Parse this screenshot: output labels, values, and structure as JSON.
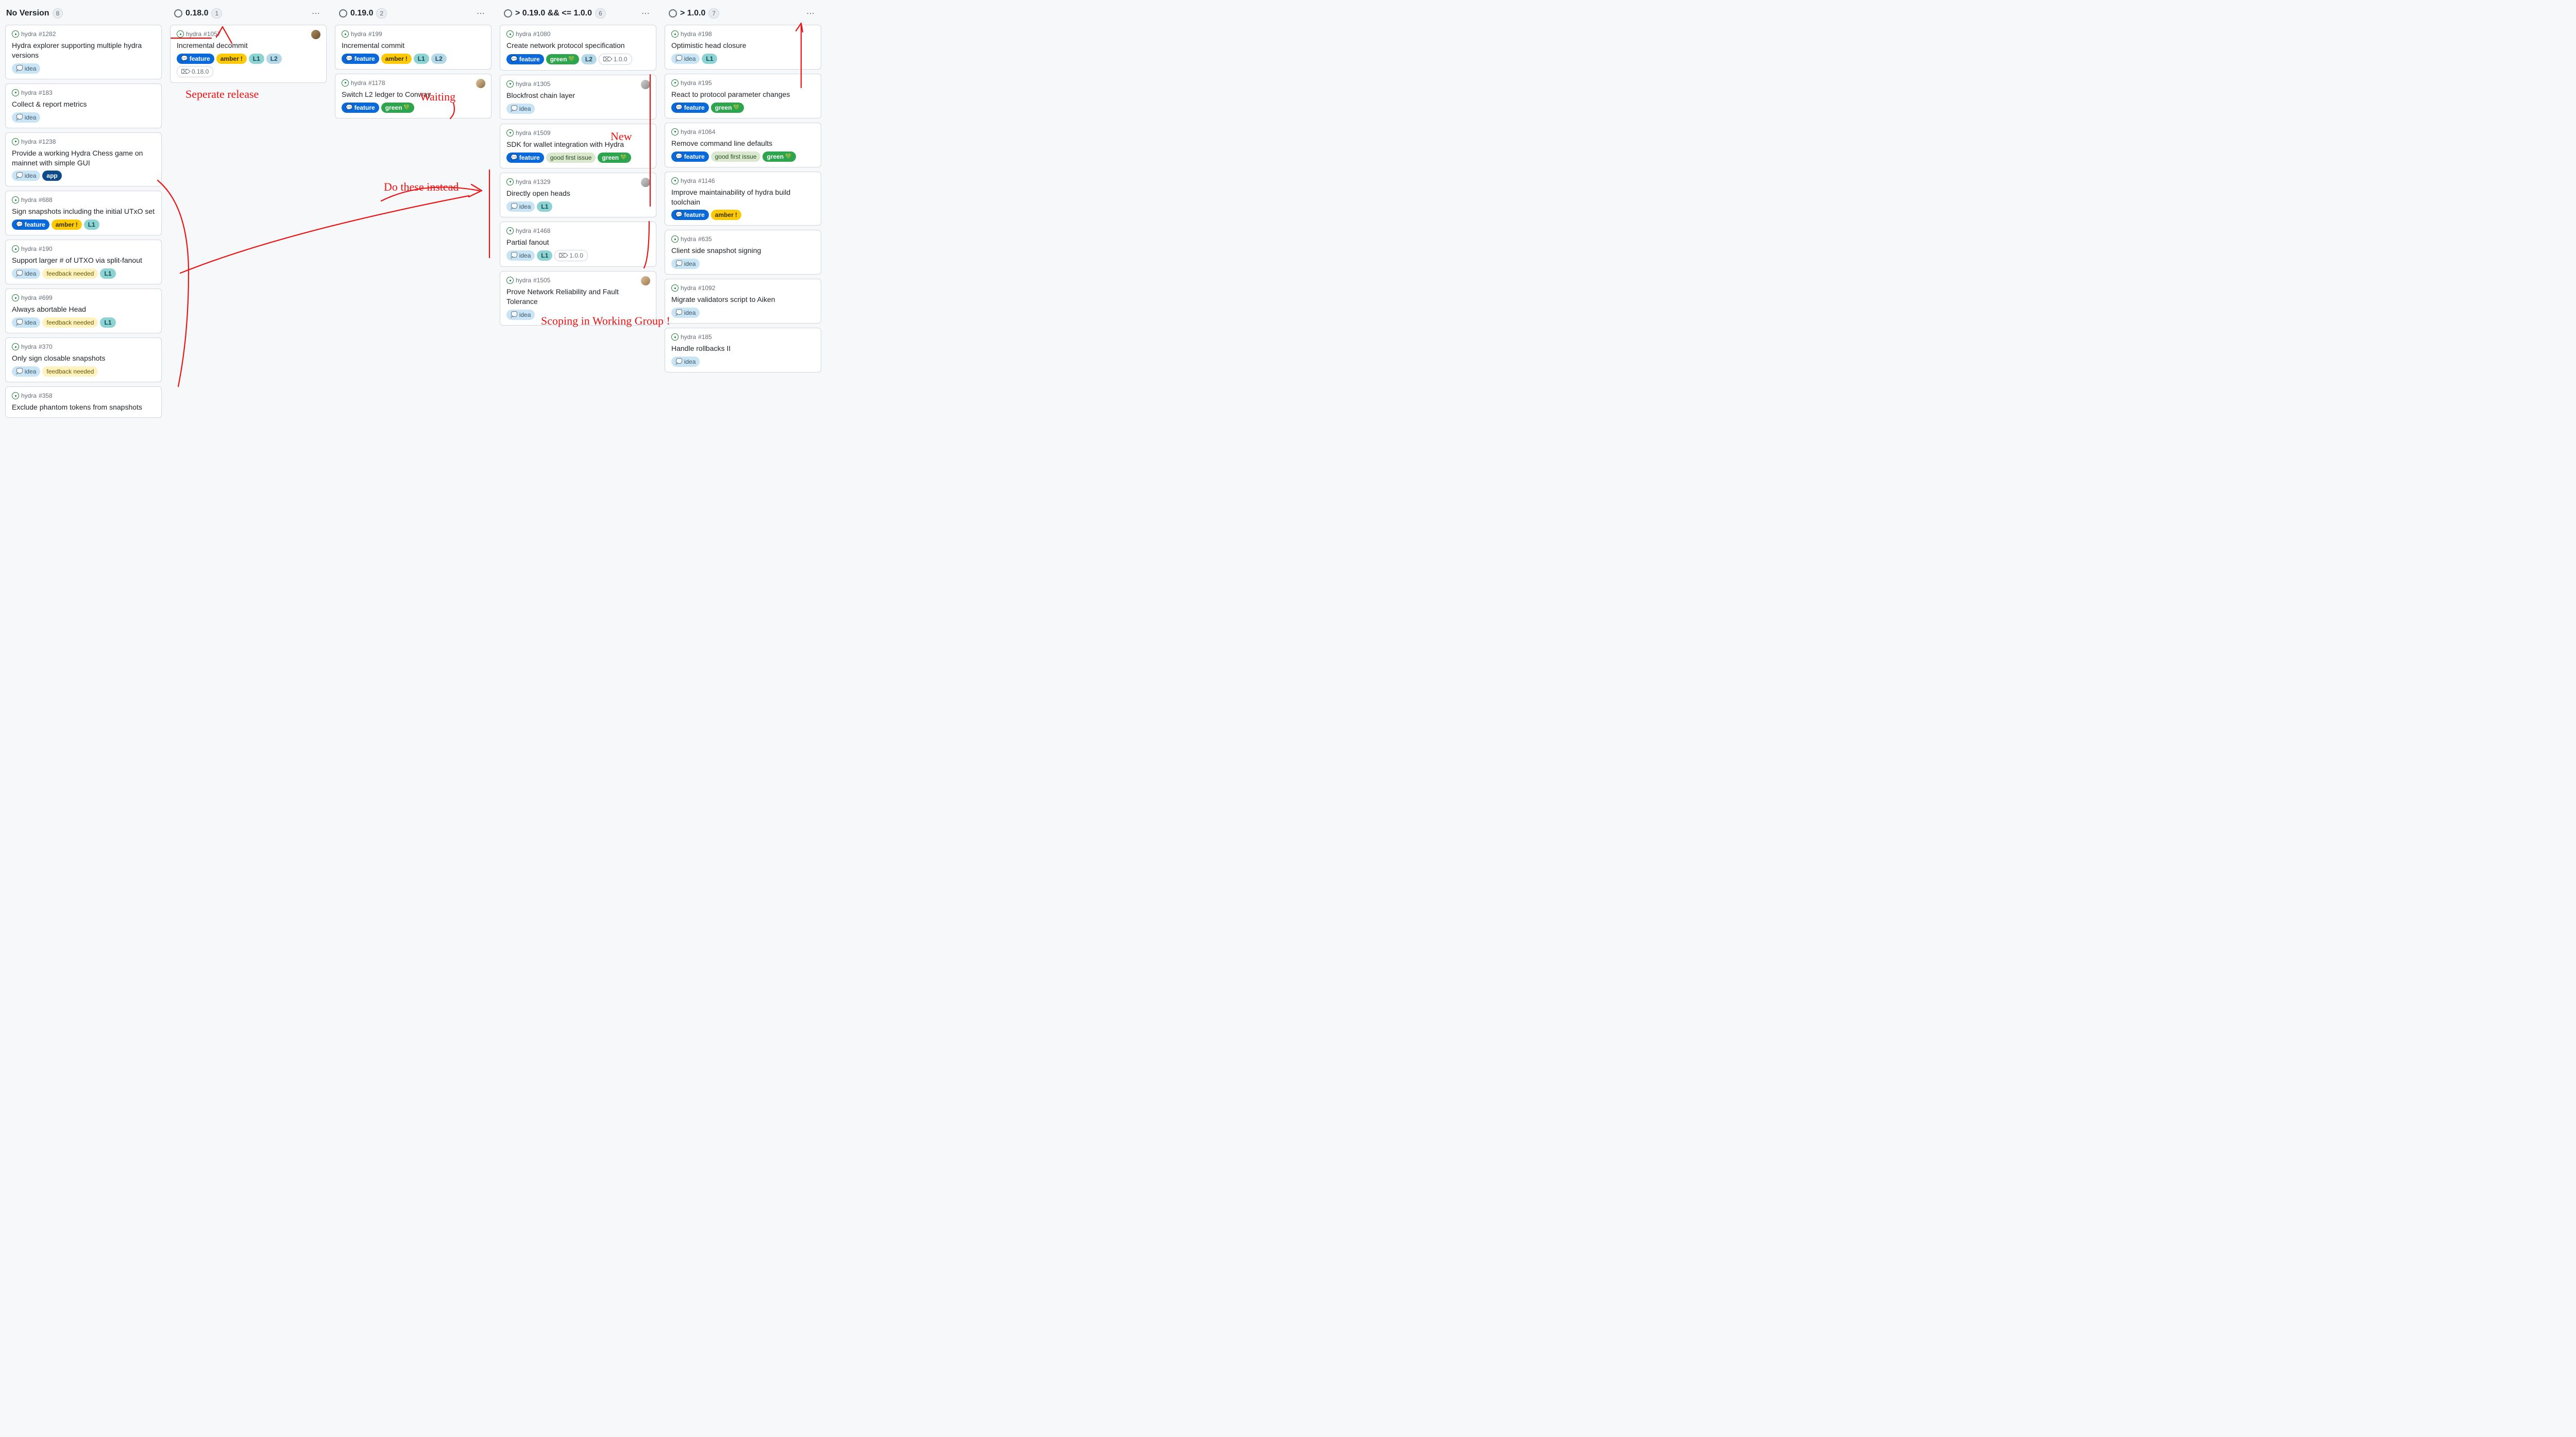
{
  "columns": [
    {
      "id": "noversion",
      "title": "No Version",
      "count": "8",
      "has_status_circle": false,
      "has_menu": false,
      "cards": [
        {
          "repo": "hydra",
          "num": "#1282",
          "title": "Hydra explorer supporting multiple hydra versions",
          "labels": [
            {
              "kind": "idea",
              "text": "idea"
            }
          ]
        },
        {
          "repo": "hydra",
          "num": "#183",
          "title": "Collect & report metrics",
          "labels": [
            {
              "kind": "idea",
              "text": "idea"
            }
          ]
        },
        {
          "repo": "hydra",
          "num": "#1238",
          "title": "Provide a working Hydra Chess game on mainnet with simple GUI",
          "labels": [
            {
              "kind": "idea",
              "text": "idea"
            },
            {
              "kind": "app",
              "text": "app"
            }
          ]
        },
        {
          "repo": "hydra",
          "num": "#688",
          "title": "Sign snapshots including the initial UTxO set",
          "labels": [
            {
              "kind": "feature",
              "text": "feature"
            },
            {
              "kind": "amber",
              "text": "amber"
            },
            {
              "kind": "L1",
              "text": "L1"
            }
          ]
        },
        {
          "repo": "hydra",
          "num": "#190",
          "title": "Support larger # of UTXO via split-fanout",
          "labels": [
            {
              "kind": "idea",
              "text": "idea"
            },
            {
              "kind": "feedback",
              "text": "feedback needed"
            },
            {
              "kind": "L1",
              "text": "L1"
            }
          ]
        },
        {
          "repo": "hydra",
          "num": "#699",
          "title": "Always abortable Head",
          "labels": [
            {
              "kind": "idea",
              "text": "idea"
            },
            {
              "kind": "feedback",
              "text": "feedback needed"
            },
            {
              "kind": "L1",
              "text": "L1"
            }
          ]
        },
        {
          "repo": "hydra",
          "num": "#370",
          "title": "Only sign closable snapshots",
          "labels": [
            {
              "kind": "idea",
              "text": "idea"
            },
            {
              "kind": "feedback",
              "text": "feedback needed"
            }
          ]
        },
        {
          "repo": "hydra",
          "num": "#358",
          "title": "Exclude phantom tokens from snapshots",
          "labels": []
        }
      ]
    },
    {
      "id": "v018",
      "title": "0.18.0",
      "count": "1",
      "has_status_circle": true,
      "has_menu": true,
      "cards": [
        {
          "repo": "hydra",
          "num": "#1057",
          "title": "Incremental decommit",
          "avatar": "a1",
          "labels": [
            {
              "kind": "feature",
              "text": "feature"
            },
            {
              "kind": "amber",
              "text": "amber"
            },
            {
              "kind": "L1",
              "text": "L1"
            },
            {
              "kind": "L2",
              "text": "L2"
            },
            {
              "kind": "milestone",
              "text": "0.18.0"
            }
          ]
        }
      ]
    },
    {
      "id": "v019",
      "title": "0.19.0",
      "count": "2",
      "has_status_circle": true,
      "has_menu": true,
      "cards": [
        {
          "repo": "hydra",
          "num": "#199",
          "title": "Incremental commit",
          "labels": [
            {
              "kind": "feature",
              "text": "feature"
            },
            {
              "kind": "amber",
              "text": "amber"
            },
            {
              "kind": "L1",
              "text": "L1"
            },
            {
              "kind": "L2",
              "text": "L2"
            }
          ]
        },
        {
          "repo": "hydra",
          "num": "#1178",
          "title": "Switch L2 ledger to Conway",
          "avatar": "a2",
          "labels": [
            {
              "kind": "feature",
              "text": "feature"
            },
            {
              "kind": "green",
              "text": "green"
            }
          ]
        }
      ]
    },
    {
      "id": "gt019lte100",
      "title": "> 0.19.0 && <= 1.0.0",
      "count": "6",
      "has_status_circle": true,
      "has_menu": true,
      "cards": [
        {
          "repo": "hydra",
          "num": "#1080",
          "title": "Create network protocol specification",
          "labels": [
            {
              "kind": "feature",
              "text": "feature"
            },
            {
              "kind": "green",
              "text": "green"
            },
            {
              "kind": "L2",
              "text": "L2"
            },
            {
              "kind": "milestone",
              "text": "1.0.0"
            }
          ]
        },
        {
          "repo": "hydra",
          "num": "#1305",
          "title": "Blockfrost chain layer",
          "avatar": "a3",
          "labels": [
            {
              "kind": "idea",
              "text": "idea"
            }
          ]
        },
        {
          "repo": "hydra",
          "num": "#1509",
          "title": "SDK for wallet integration with Hydra",
          "labels": [
            {
              "kind": "feature",
              "text": "feature"
            },
            {
              "kind": "goodfirst",
              "text": "good first issue"
            },
            {
              "kind": "green",
              "text": "green"
            }
          ]
        },
        {
          "repo": "hydra",
          "num": "#1329",
          "title": "Directly open heads",
          "avatar": "a3",
          "labels": [
            {
              "kind": "idea",
              "text": "idea"
            },
            {
              "kind": "L1",
              "text": "L1"
            }
          ]
        },
        {
          "repo": "hydra",
          "num": "#1468",
          "title": "Partial fanout",
          "labels": [
            {
              "kind": "idea",
              "text": "idea"
            },
            {
              "kind": "L1",
              "text": "L1"
            },
            {
              "kind": "milestone",
              "text": "1.0.0"
            }
          ]
        },
        {
          "repo": "hydra",
          "num": "#1505",
          "title": "Prove Network Reliability and Fault Tolerance",
          "avatar": "a4",
          "labels": [
            {
              "kind": "idea",
              "text": "idea"
            }
          ]
        }
      ]
    },
    {
      "id": "gt100",
      "title": "> 1.0.0",
      "count": "7",
      "has_status_circle": true,
      "has_menu": true,
      "cards": [
        {
          "repo": "hydra",
          "num": "#198",
          "title": "Optimistic head closure",
          "labels": [
            {
              "kind": "idea",
              "text": "idea"
            },
            {
              "kind": "L1",
              "text": "L1"
            }
          ]
        },
        {
          "repo": "hydra",
          "num": "#195",
          "title": "React to protocol parameter changes",
          "labels": [
            {
              "kind": "feature",
              "text": "feature"
            },
            {
              "kind": "green",
              "text": "green"
            }
          ]
        },
        {
          "repo": "hydra",
          "num": "#1064",
          "title": "Remove command line defaults",
          "labels": [
            {
              "kind": "feature",
              "text": "feature"
            },
            {
              "kind": "goodfirst",
              "text": "good first issue"
            },
            {
              "kind": "green",
              "text": "green"
            }
          ]
        },
        {
          "repo": "hydra",
          "num": "#1146",
          "title": "Improve maintainability of hydra build toolchain",
          "labels": [
            {
              "kind": "feature",
              "text": "feature"
            },
            {
              "kind": "amber",
              "text": "amber"
            }
          ]
        },
        {
          "repo": "hydra",
          "num": "#635",
          "title": "Client side snapshot signing",
          "labels": [
            {
              "kind": "idea",
              "text": "idea"
            }
          ]
        },
        {
          "repo": "hydra",
          "num": "#1092",
          "title": "Migrate validators script to Aiken",
          "labels": [
            {
              "kind": "idea",
              "text": "idea"
            }
          ]
        },
        {
          "repo": "hydra",
          "num": "#185",
          "title": "Handle rollbacks II",
          "labels": [
            {
              "kind": "idea",
              "text": "idea"
            }
          ]
        }
      ]
    }
  ],
  "annotations": {
    "sep_release": "Seperate release",
    "waiting": "Waiting",
    "do_these": "Do these instead",
    "new": "New",
    "scoping": "Scoping in Working Group !"
  }
}
